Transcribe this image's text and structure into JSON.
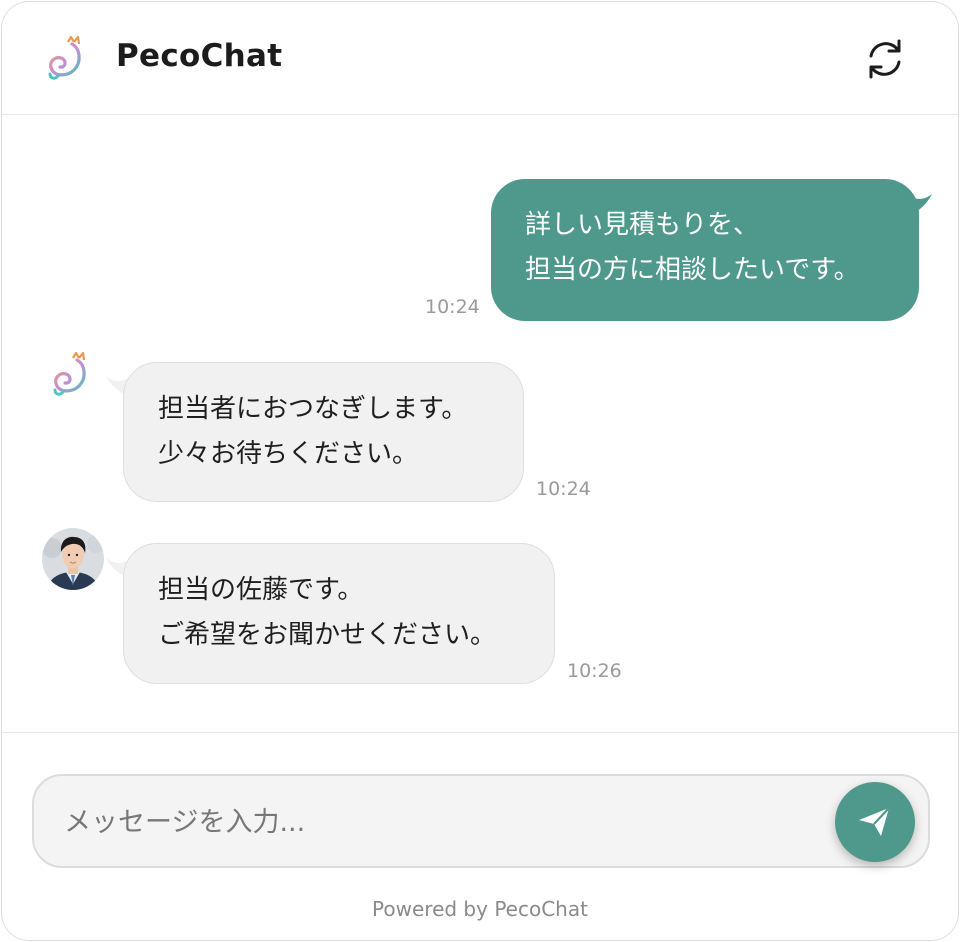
{
  "header": {
    "title": "PecoChat",
    "logo_icon": "cat-logo-icon",
    "refresh_icon": "refresh-icon"
  },
  "messages": [
    {
      "sender": "user",
      "lines": [
        "詳しい見積もりを、",
        "担当の方に相談したいです。"
      ],
      "time": "10:24"
    },
    {
      "sender": "bot",
      "avatar": "cat-logo-icon",
      "lines": [
        "担当者におつなぎします。",
        "少々お待ちください。"
      ],
      "time": "10:24"
    },
    {
      "sender": "agent",
      "avatar": "agent-avatar",
      "lines": [
        "担当の佐藤です。",
        "ご希望をお聞かせください。"
      ],
      "time": "10:26"
    }
  ],
  "composer": {
    "placeholder": "メッセージを入力...",
    "value": "",
    "send_icon": "send-icon"
  },
  "footer": {
    "powered_by": "Powered by PecoChat"
  },
  "colors": {
    "accent": "#4e998b",
    "agent_bubble": "#f1f1f1",
    "timestamp": "#9a9a9a"
  }
}
